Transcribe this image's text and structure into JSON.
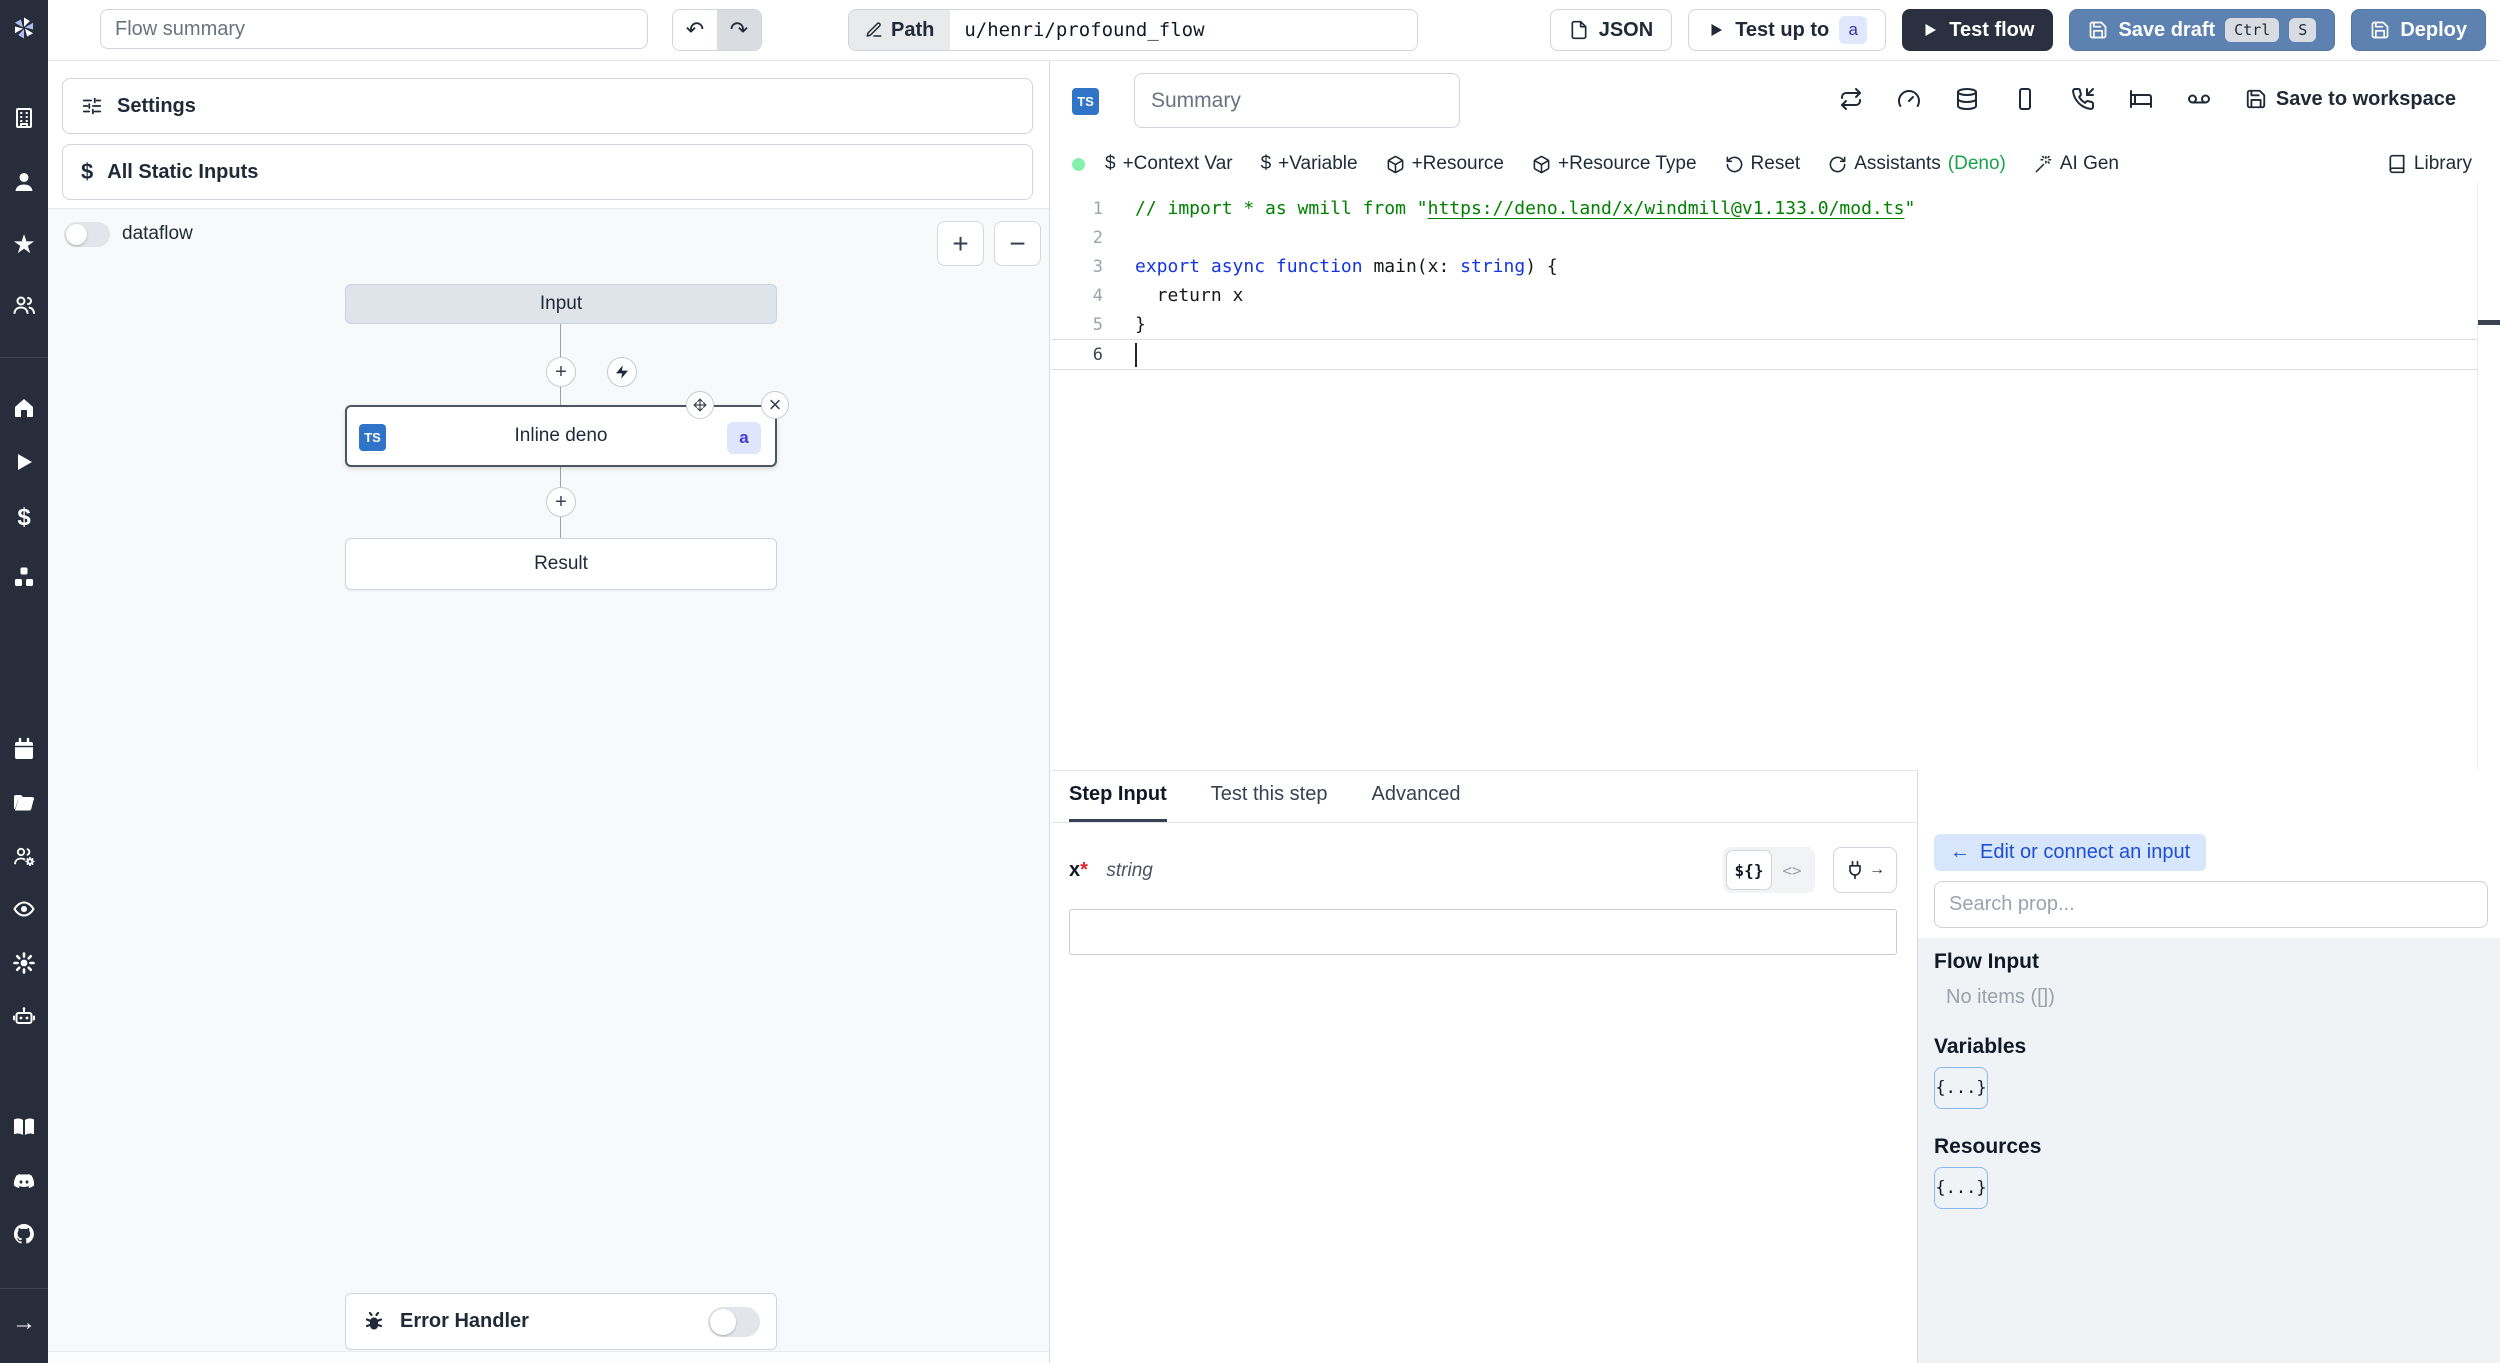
{
  "topbar": {
    "flow_summary_placeholder": "Flow summary",
    "path_label": "Path",
    "path_value": "u/henri/profound_flow",
    "json_button": "JSON",
    "test_up_to": "Test up to",
    "test_up_to_badge": "a",
    "test_flow": "Test flow",
    "save_draft": "Save draft",
    "kbd_ctrl": "Ctrl",
    "kbd_s": "S",
    "deploy": "Deploy"
  },
  "sidebar": {
    "icons": [
      "windmill-logo",
      "workspace",
      "user",
      "favorites",
      "groups",
      "home",
      "runs",
      "variables",
      "resources",
      "schedules",
      "folders",
      "workers",
      "audit-logs",
      "settings",
      "assistants",
      "docs",
      "discord",
      "github",
      "expand"
    ]
  },
  "flow_panel": {
    "settings": "Settings",
    "all_static_inputs": "All Static Inputs",
    "dataflow_label": "dataflow",
    "nodes": {
      "input": "Input",
      "step": "Inline deno",
      "step_lang": "TS",
      "step_badge": "a",
      "result": "Result"
    },
    "error_handler": "Error Handler"
  },
  "editor": {
    "lang_badge": "TS",
    "summary_placeholder": "Summary",
    "save_to_workspace": "Save to workspace",
    "toolbar": {
      "context_var": "+Context Var",
      "variable": "+Variable",
      "resource": "+Resource",
      "resource_type": "+Resource Type",
      "reset": "Reset",
      "assistants": "Assistants",
      "assistants_lang": "(Deno)",
      "ai_gen": "AI Gen",
      "library": "Library"
    },
    "code": {
      "lines": [
        {
          "num": "1",
          "segs": [
            {
              "t": "// import * as wmill from \"",
              "c": "com"
            },
            {
              "t": "https://deno.land/x/windmill@v1.133.0/mod.ts",
              "c": "url"
            },
            {
              "t": "\"",
              "c": "com"
            }
          ]
        },
        {
          "num": "2",
          "segs": []
        },
        {
          "num": "3",
          "segs": [
            {
              "t": "export",
              "c": "kw"
            },
            {
              "t": " ",
              "c": "pl"
            },
            {
              "t": "async",
              "c": "kw"
            },
            {
              "t": " ",
              "c": "pl"
            },
            {
              "t": "function",
              "c": "kw"
            },
            {
              "t": " main(x: ",
              "c": "pl"
            },
            {
              "t": "string",
              "c": "kw"
            },
            {
              "t": ") {",
              "c": "pl"
            }
          ]
        },
        {
          "num": "4",
          "segs": [
            {
              "t": "  return x",
              "c": "pl"
            }
          ]
        },
        {
          "num": "5",
          "segs": [
            {
              "t": "}",
              "c": "pl"
            }
          ]
        },
        {
          "num": "6",
          "segs": [],
          "current": true
        }
      ]
    }
  },
  "step_panel": {
    "tabs": [
      {
        "label": "Step Input",
        "active": true
      },
      {
        "label": "Test this step",
        "active": false
      },
      {
        "label": "Advanced",
        "active": false
      }
    ],
    "field_name": "x",
    "field_required": "*",
    "field_type": "string",
    "input_value": ""
  },
  "prop_panel": {
    "edit_connect": "Edit or connect an input",
    "search_placeholder": "Search prop...",
    "sections": [
      {
        "title": "Flow Input",
        "empty": "No items ([])"
      },
      {
        "title": "Variables",
        "chip": "{...}"
      },
      {
        "title": "Resources",
        "chip": "{...}"
      }
    ]
  },
  "glyphs": {
    "plus": "+",
    "minus": "−",
    "close": "×",
    "undo": "↶",
    "redo": "↷",
    "arrow_left": "←",
    "arrow_right": "→",
    "dollar": "$",
    "star": "★",
    "expr_toggle": "${}",
    "code_toggle": "<>"
  },
  "colors": {
    "sidebar_bg": "#272d3a",
    "steel_blue_button": "#5d82b2",
    "dark_button": "#2a3040",
    "ts_badge": "#3074c8",
    "badge_bg": "#e0e7ff",
    "badge_text": "#3730a3",
    "deno_green": "#16a34a",
    "status_green": "#86efac",
    "graph_bg": "#f7f9fa",
    "prop_panel_bg": "#f0f3f5"
  }
}
